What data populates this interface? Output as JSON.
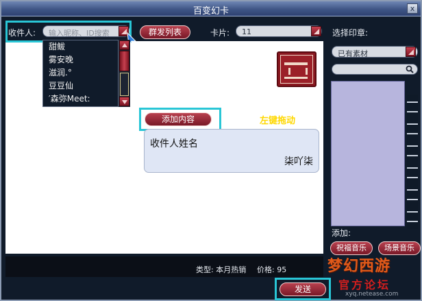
{
  "window": {
    "title": "百变幻卡",
    "close_glyph": "x"
  },
  "recipient": {
    "label": "收件人:",
    "placeholder": "输入昵称、ID搜索",
    "list": [
      "甜鲅",
      "雾安晚",
      "滋润.°",
      "豆豆仙",
      "′森弥Meet:"
    ]
  },
  "toolbar": {
    "group_list_label": "群发列表",
    "card_label": "卡片:",
    "card_value": "11",
    "stamp_label": "选择印章:"
  },
  "stamp_panel": {
    "source_value": "已有素材",
    "add_label": "添加:",
    "bless_music_label": "祝福音乐",
    "scene_music_label": "场景音乐"
  },
  "editor": {
    "add_content_label": "添加内容",
    "drag_hint": "左键拖动",
    "card_name": "收件人姓名",
    "card_signature": "柒吖柒"
  },
  "footer": {
    "type_label": "类型: 本月热销",
    "price_label": "价格: 95",
    "send_label": "发送"
  },
  "logo": {
    "main_text": "梦幻西游",
    "forum_text": "官方论坛",
    "url_text": "xyq.netease.com"
  },
  "icons": {
    "search": "magnifier-icon",
    "dropdown": "triangle-dropdown-icon",
    "stamp": "palace-seal-icon"
  },
  "colors": {
    "accent_red": "#8e1b27",
    "highlight_cyan": "#29c6d6",
    "hint_yellow": "#ffd800",
    "titlebar_blue": "#4a6396"
  }
}
